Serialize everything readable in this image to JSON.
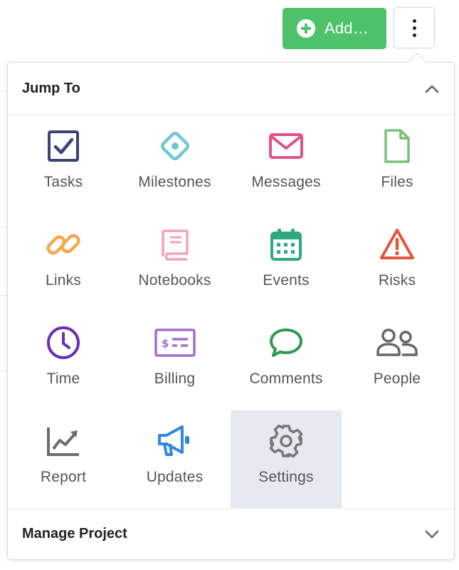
{
  "toolbar": {
    "add_label": "Add…",
    "add_color": "#4ec26b"
  },
  "menu": {
    "header_title": "Jump To",
    "footer_title": "Manage Project",
    "items": [
      {
        "label": "Tasks",
        "icon": "tasks-icon",
        "color": "#3a4373"
      },
      {
        "label": "Milestones",
        "icon": "milestone-icon",
        "color": "#6fc8d0"
      },
      {
        "label": "Messages",
        "icon": "envelope-icon",
        "color": "#e0528b"
      },
      {
        "label": "Files",
        "icon": "file-icon",
        "color": "#7cc07a"
      },
      {
        "label": "Links",
        "icon": "link-icon",
        "color": "#f5a84c"
      },
      {
        "label": "Notebooks",
        "icon": "notebook-icon",
        "color": "#f2a3b6"
      },
      {
        "label": "Events",
        "icon": "calendar-icon",
        "color": "#2eaa7e"
      },
      {
        "label": "Risks",
        "icon": "warning-icon",
        "color": "#e4553a"
      },
      {
        "label": "Time",
        "icon": "clock-icon",
        "color": "#6a2fb4"
      },
      {
        "label": "Billing",
        "icon": "billing-icon",
        "color": "#a26fd0"
      },
      {
        "label": "Comments",
        "icon": "comment-icon",
        "color": "#2e9b4f"
      },
      {
        "label": "People",
        "icon": "people-icon",
        "color": "#666666"
      },
      {
        "label": "Report",
        "icon": "chart-icon",
        "color": "#6d6d6d"
      },
      {
        "label": "Updates",
        "icon": "megaphone-icon",
        "color": "#2f87e0"
      },
      {
        "label": "Settings",
        "icon": "gear-icon",
        "color": "#777777",
        "active": true
      }
    ]
  }
}
